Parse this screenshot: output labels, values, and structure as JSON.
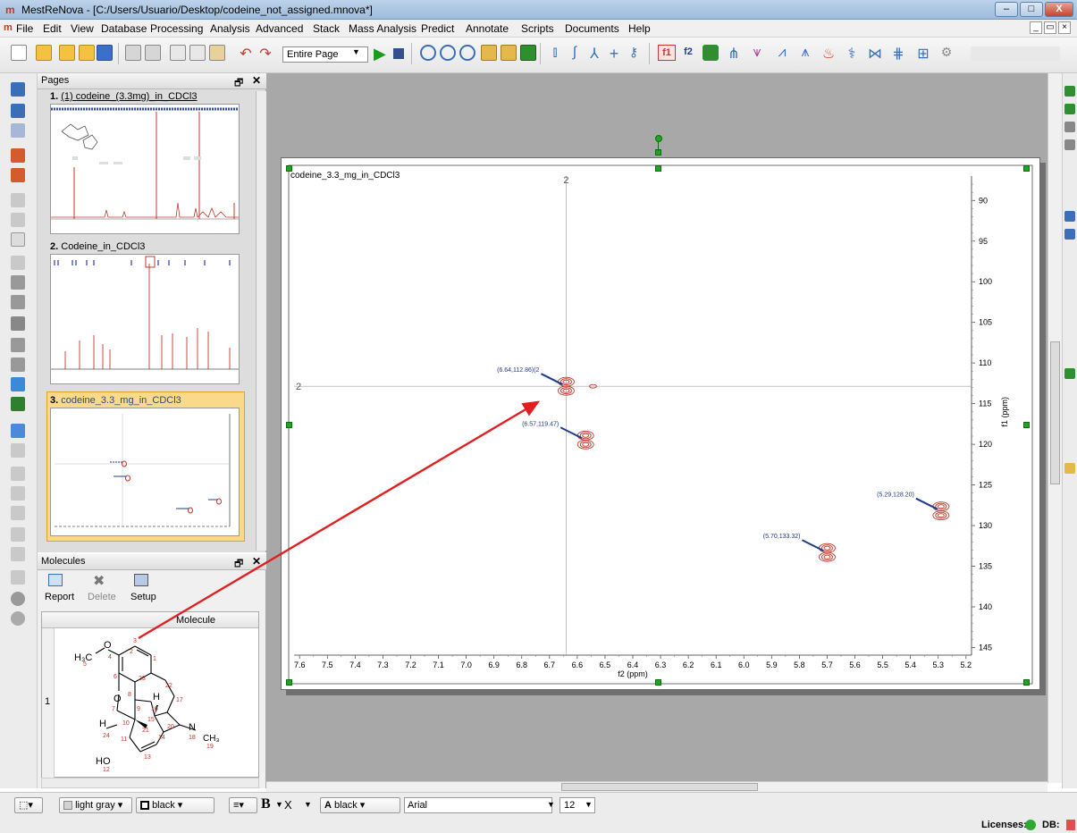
{
  "window": {
    "title": "MestReNova - [C:/Users/Usuario/Desktop/codeine_not_assigned.mnova*]",
    "app_icon": "m-logo-icon",
    "buttons": {
      "minimize": "–",
      "maximize": "□",
      "close": "X"
    }
  },
  "menu": {
    "icon": "m",
    "items": [
      "File",
      "Edit",
      "View",
      "Database",
      "Processing",
      "Analysis",
      "Advanced",
      "Stack",
      "Mass Analysis",
      "Predict",
      "Annotate",
      "Scripts",
      "Documents",
      "Help"
    ],
    "right_controls": [
      "_",
      "▭",
      "×"
    ]
  },
  "toolbar": {
    "zoom_select": "Entire Page",
    "f1_label": "f1",
    "f2_label": "f2"
  },
  "pages_panel": {
    "header": "Pages",
    "pages": [
      {
        "number": "1.",
        "title": "(1) codeine_(3.3mg)_in_CDCl3"
      },
      {
        "number": "2.",
        "title": "Codeine_in_CDCl3"
      },
      {
        "number": "3.",
        "title": "codeine_3.3_mg_in_CDCl3"
      }
    ]
  },
  "molecules_panel": {
    "header": "Molecules",
    "buttons": [
      "Report",
      "Delete",
      "Setup"
    ],
    "column_header": "Molecule",
    "row_number": "1",
    "labels": {
      "methyl_group": "H₃C",
      "oxygen_top": "O",
      "oxygen_bridge": "O",
      "hydrogen_top": "H",
      "hydrogen_left": "H",
      "nitrogen": "N",
      "methyl_n": "CH₃",
      "hydroxyl": "HO"
    },
    "atom_numbers": [
      "5",
      "4",
      "3",
      "2",
      "1",
      "6",
      "23",
      "22",
      "7",
      "8",
      "16",
      "17",
      "10",
      "9",
      "15",
      "24",
      "21",
      "20",
      "18",
      "19",
      "11",
      "14",
      "13",
      "12"
    ]
  },
  "spectrum": {
    "title": "codeine_3.3_mg_in_CDCl3",
    "cursor_label_top": "2",
    "cursor_label_left": "2",
    "xlabel": "f2 (ppm)",
    "ylabel": "f1 (ppm)",
    "x_ticks": [
      "7.6",
      "7.5",
      "7.4",
      "7.3",
      "7.2",
      "7.1",
      "7.0",
      "6.9",
      "6.8",
      "6.7",
      "6.6",
      "6.5",
      "6.4",
      "6.3",
      "6.2",
      "6.1",
      "6.0",
      "5.9",
      "5.8",
      "5.7",
      "5.6",
      "5.5",
      "5.4",
      "5.3",
      "5.2"
    ],
    "y_ticks": [
      "90",
      "95",
      "100",
      "105",
      "110",
      "115",
      "120",
      "125",
      "130",
      "135",
      "140",
      "145"
    ],
    "peaks": [
      {
        "label": "(6.64,112.86)(2",
        "x": 6.64,
        "y": 112.86
      },
      {
        "label": "(6.57,119.47)",
        "x": 6.57,
        "y": 119.47
      },
      {
        "label": "(5.70,133.32)",
        "x": 5.7,
        "y": 133.32
      },
      {
        "label": "(5.29,128.20)",
        "x": 5.29,
        "y": 128.2
      }
    ],
    "xlim": [
      7.62,
      5.18
    ],
    "ylim": [
      87,
      145.5
    ]
  },
  "format_bar": {
    "fill_color": "light gray",
    "line_color": "black",
    "bold": "B",
    "subscript": "X",
    "font_color": "black",
    "font_color_prefix": "A",
    "font": "Arial",
    "size": "12"
  },
  "status": {
    "licenses": "Licenses:",
    "db": "DB:"
  },
  "colors": {
    "accent": "#f2c46a",
    "contour": "#c0392b",
    "annotation": "#1f3a8a",
    "arrow": "#e02020",
    "handle": "#1ea71e"
  }
}
